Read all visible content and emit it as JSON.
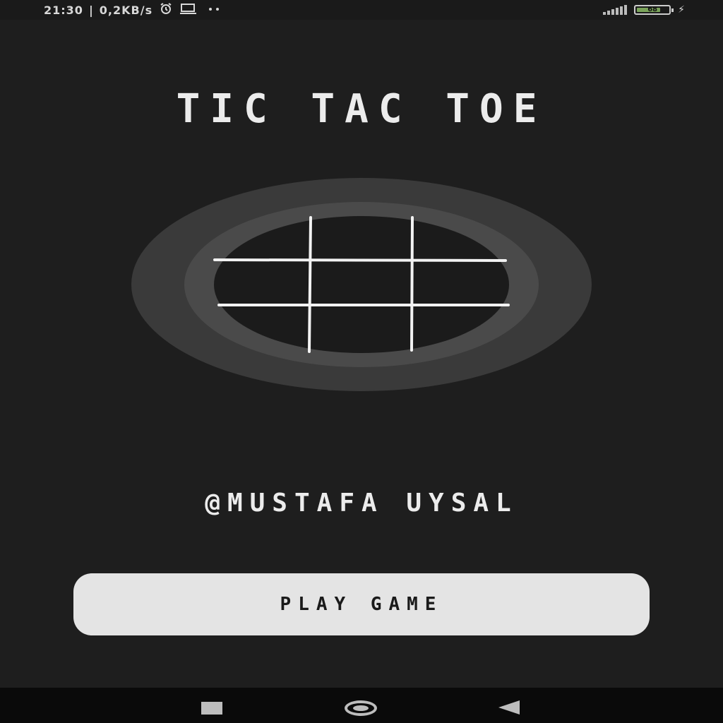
{
  "status_bar": {
    "time": "21:30",
    "separator": "|",
    "network_speed": "0,2KB/s",
    "icons": [
      "alarm-icon",
      "cast-icon",
      "more-dots-icon",
      "signal-icon",
      "battery-icon",
      "charging-icon"
    ],
    "battery_level": "68"
  },
  "app": {
    "title": "TIC TAC TOE",
    "author": "@MUSTAFA UYSAL",
    "play_button_label": "PLAY GAME",
    "colors": {
      "background": "#1e1e1e",
      "outer_ring": "#3a3a3a",
      "inner_ring": "#4a4a4a",
      "board": "#1b1b1b",
      "grid_lines": "#f2f2f2",
      "button": "#e4e4e4",
      "button_text": "#1a1a1a"
    }
  },
  "nav_bar": {
    "icons": [
      "recent-apps-icon",
      "home-icon",
      "back-icon"
    ]
  }
}
